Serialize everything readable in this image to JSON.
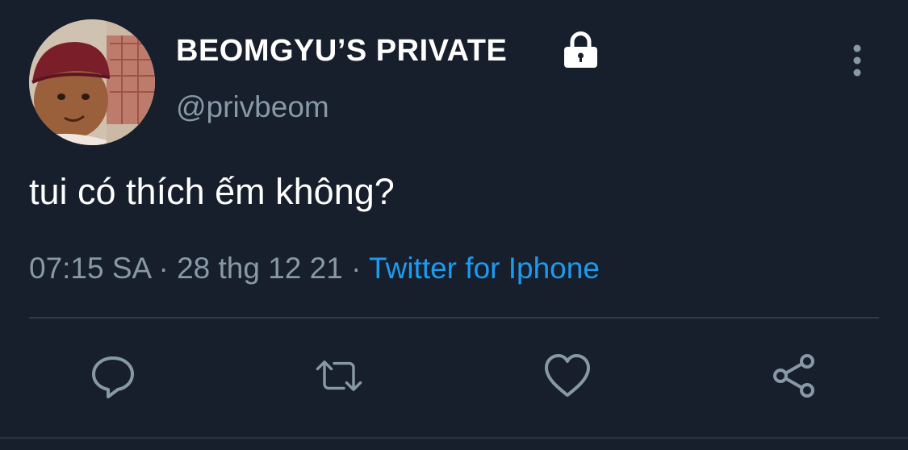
{
  "tweet": {
    "display_name": "BEOMGYU’S PRIVATE",
    "handle": "@privbeom",
    "protected": true,
    "text": "tui có thích ếm không?",
    "time": "07:15 SA",
    "separator": " · ",
    "date": "28 thg 12 21",
    "source": "Twitter for Iphone"
  },
  "icons": {
    "lock": "lock-icon",
    "more": "more-vertical-icon",
    "reply": "reply-icon",
    "retweet": "retweet-icon",
    "like": "heart-icon",
    "share": "share-icon"
  },
  "colors": {
    "background": "#161f2b",
    "primary_text": "#ffffff",
    "secondary_text": "#8899a6",
    "link": "#1d9bf0",
    "divider": "#2f3b47"
  }
}
